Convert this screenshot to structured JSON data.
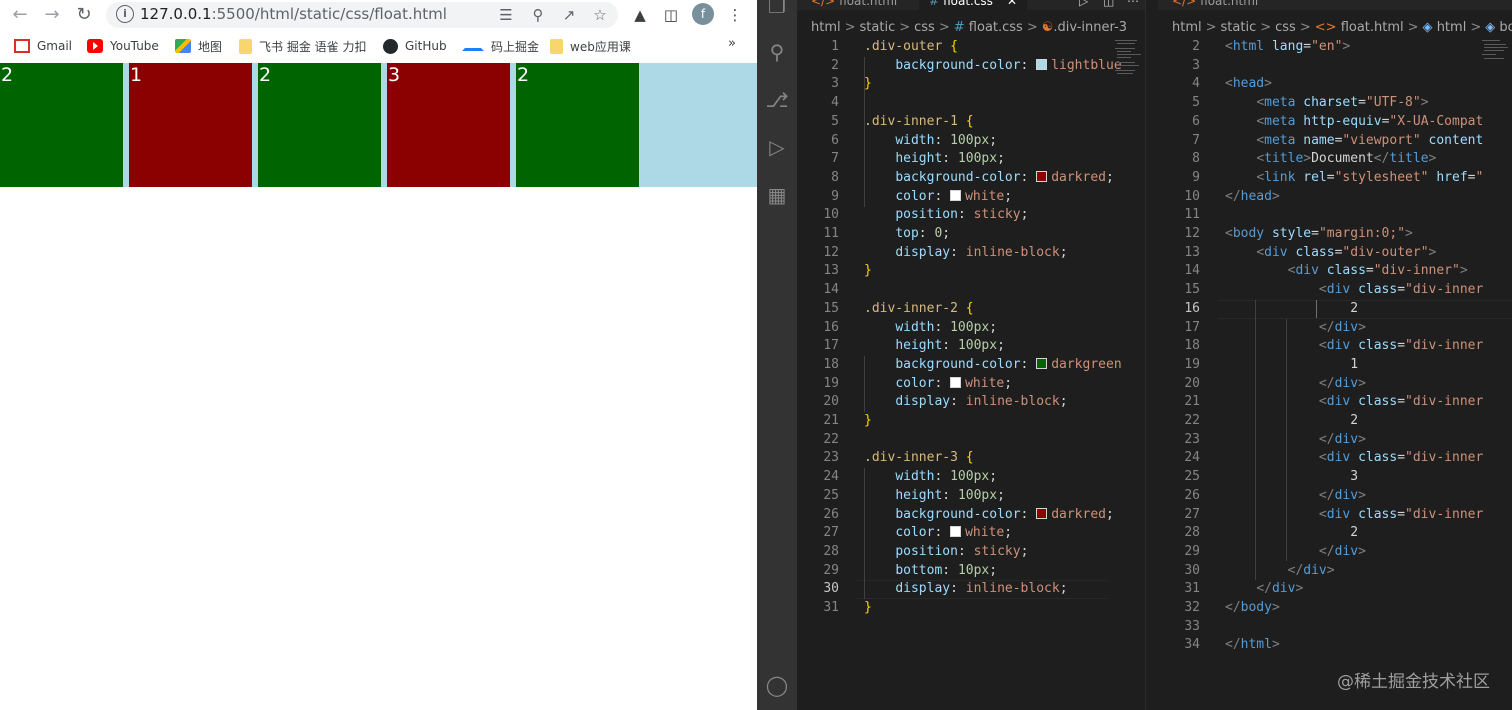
{
  "browser": {
    "url_host": "127.0.0.1",
    "url_path": ":5500/html/static/css/float.html",
    "profile_initial": "f",
    "bookmarks": [
      {
        "label": "Gmail"
      },
      {
        "label": "YouTube"
      },
      {
        "label": "地图"
      },
      {
        "label": "飞书 掘金 语雀 力扣"
      },
      {
        "label": "GitHub"
      },
      {
        "label": "码上掘金"
      },
      {
        "label": "web应用课"
      }
    ],
    "more": "»"
  },
  "page": {
    "boxes": [
      {
        "text": "2",
        "color": "darkgreen"
      },
      {
        "text": "1",
        "color": "darkred"
      },
      {
        "text": "2",
        "color": "darkgreen"
      },
      {
        "text": "3",
        "color": "darkred"
      },
      {
        "text": "2",
        "color": "darkgreen"
      }
    ],
    "outer_bg": "lightblue"
  },
  "editor_left": {
    "tabs": [
      {
        "label": "float.html"
      },
      {
        "label": "float.css"
      }
    ],
    "breadcrumb": [
      "html",
      "static",
      "css",
      "float.css",
      ".div-inner-3"
    ],
    "current_line": 30
  },
  "editor_right": {
    "tabs": [
      {
        "label": "float.html"
      }
    ],
    "breadcrumb": [
      "html",
      "static",
      "css",
      "float.html",
      "html",
      "body"
    ],
    "current_line": 16
  },
  "watermark": "@稀土掘金技术社区"
}
